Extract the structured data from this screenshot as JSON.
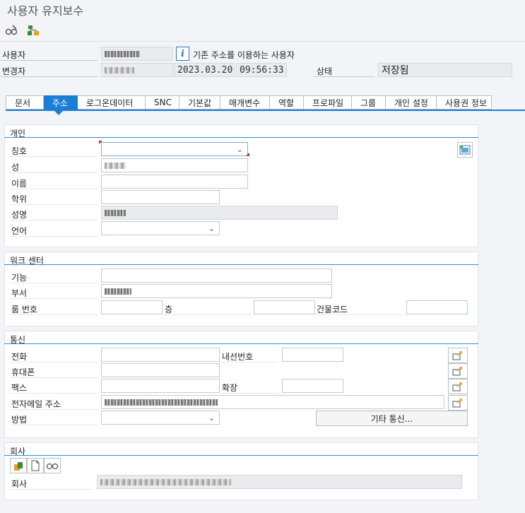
{
  "window": {
    "title": "사용자 유지보수"
  },
  "header": {
    "user_label": "사용자",
    "changed_by_label": "변경자",
    "info_text": "기존 주소를 이용하는 사용자",
    "date": "2023.03.20",
    "time": "09:56:33",
    "status_label": "상태",
    "status_value": "저장됨"
  },
  "tabs": [
    {
      "label": "문서"
    },
    {
      "label": "주소"
    },
    {
      "label": "로그온데이터"
    },
    {
      "label": "SNC"
    },
    {
      "label": "기본값"
    },
    {
      "label": "매개변수"
    },
    {
      "label": "역할"
    },
    {
      "label": "프로파일"
    },
    {
      "label": "그룹"
    },
    {
      "label": "개인 설정"
    },
    {
      "label": "사용권 정보"
    }
  ],
  "personal": {
    "title": "개인",
    "salutation_label": "칭호",
    "last_name_label": "성",
    "first_name_label": "이름",
    "degree_label": "학위",
    "full_name_label": "성명",
    "language_label": "언어"
  },
  "workcenter": {
    "title": "워크 센터",
    "function_label": "기능",
    "department_label": "부서",
    "room_label": "룸 번호",
    "floor_label": "층",
    "building_label": "건물코드"
  },
  "comm": {
    "title": "통신",
    "phone_label": "전화",
    "extension_label": "내선번호",
    "mobile_label": "휴대폰",
    "fax_label": "팩스",
    "fax_ext_label": "확장",
    "email_label": "전자메일 주소",
    "method_label": "방법",
    "other_button": "기타 통신..."
  },
  "company": {
    "title": "회사",
    "company_label": "회사"
  },
  "colors": {
    "accent": "#1b7ed6",
    "group_line": "#2a8fd9"
  }
}
